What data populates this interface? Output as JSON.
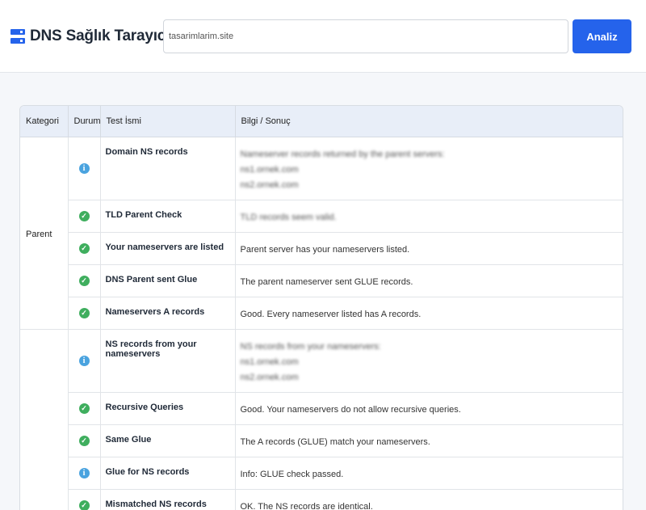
{
  "app": {
    "title": "DNS Sağlık Tarayıcısı",
    "search_value": "tasarimlarim.site",
    "analyze_label": "Analiz"
  },
  "table": {
    "headers": [
      "Kategori",
      "Durum",
      "Test İsmi",
      "Bilgi / Sonuç"
    ],
    "groups": [
      {
        "category": "Parent",
        "rows": [
          {
            "status": "info",
            "test": "Domain NS records",
            "info": [
              "Nameserver records returned by the parent servers:",
              "ns1.ornek.com",
              "ns2.ornek.com"
            ],
            "blurred": true
          },
          {
            "status": "ok",
            "test": "TLD Parent Check",
            "info": [
              "TLD records seem valid."
            ],
            "blurred": true
          },
          {
            "status": "ok",
            "test": "Your nameservers are listed",
            "info": [
              "Parent server has your nameservers listed."
            ],
            "blurred": false
          },
          {
            "status": "ok",
            "test": "DNS Parent sent Glue",
            "info": [
              "The parent nameserver sent GLUE records."
            ],
            "blurred": false
          },
          {
            "status": "ok",
            "test": "Nameservers A records",
            "info": [
              "Good. Every nameserver listed has A records."
            ],
            "blurred": false
          }
        ]
      },
      {
        "category": "",
        "rows": [
          {
            "status": "info",
            "test": "NS records from your nameservers",
            "info": [
              "NS records from your nameservers:",
              "ns1.ornek.com",
              "ns2.ornek.com"
            ],
            "blurred": true
          },
          {
            "status": "ok",
            "test": "Recursive Queries",
            "info": [
              "Good. Your nameservers do not allow recursive queries."
            ],
            "blurred": false
          },
          {
            "status": "ok",
            "test": "Same Glue",
            "info": [
              "The A records (GLUE) match your nameservers."
            ],
            "blurred": false
          },
          {
            "status": "info",
            "test": "Glue for NS records",
            "info": [
              "Info: GLUE check passed."
            ],
            "blurred": false
          },
          {
            "status": "ok",
            "test": "Mismatched NS records",
            "info": [
              "OK. The NS records are identical."
            ],
            "blurred": false
          }
        ]
      }
    ]
  },
  "colors": {
    "accent": "#2563eb",
    "ok": "#3fae5e",
    "info": "#4aa3df"
  },
  "icons": {
    "brand": "server-icon",
    "ok": "check-circle-icon",
    "info": "info-circle-icon"
  }
}
